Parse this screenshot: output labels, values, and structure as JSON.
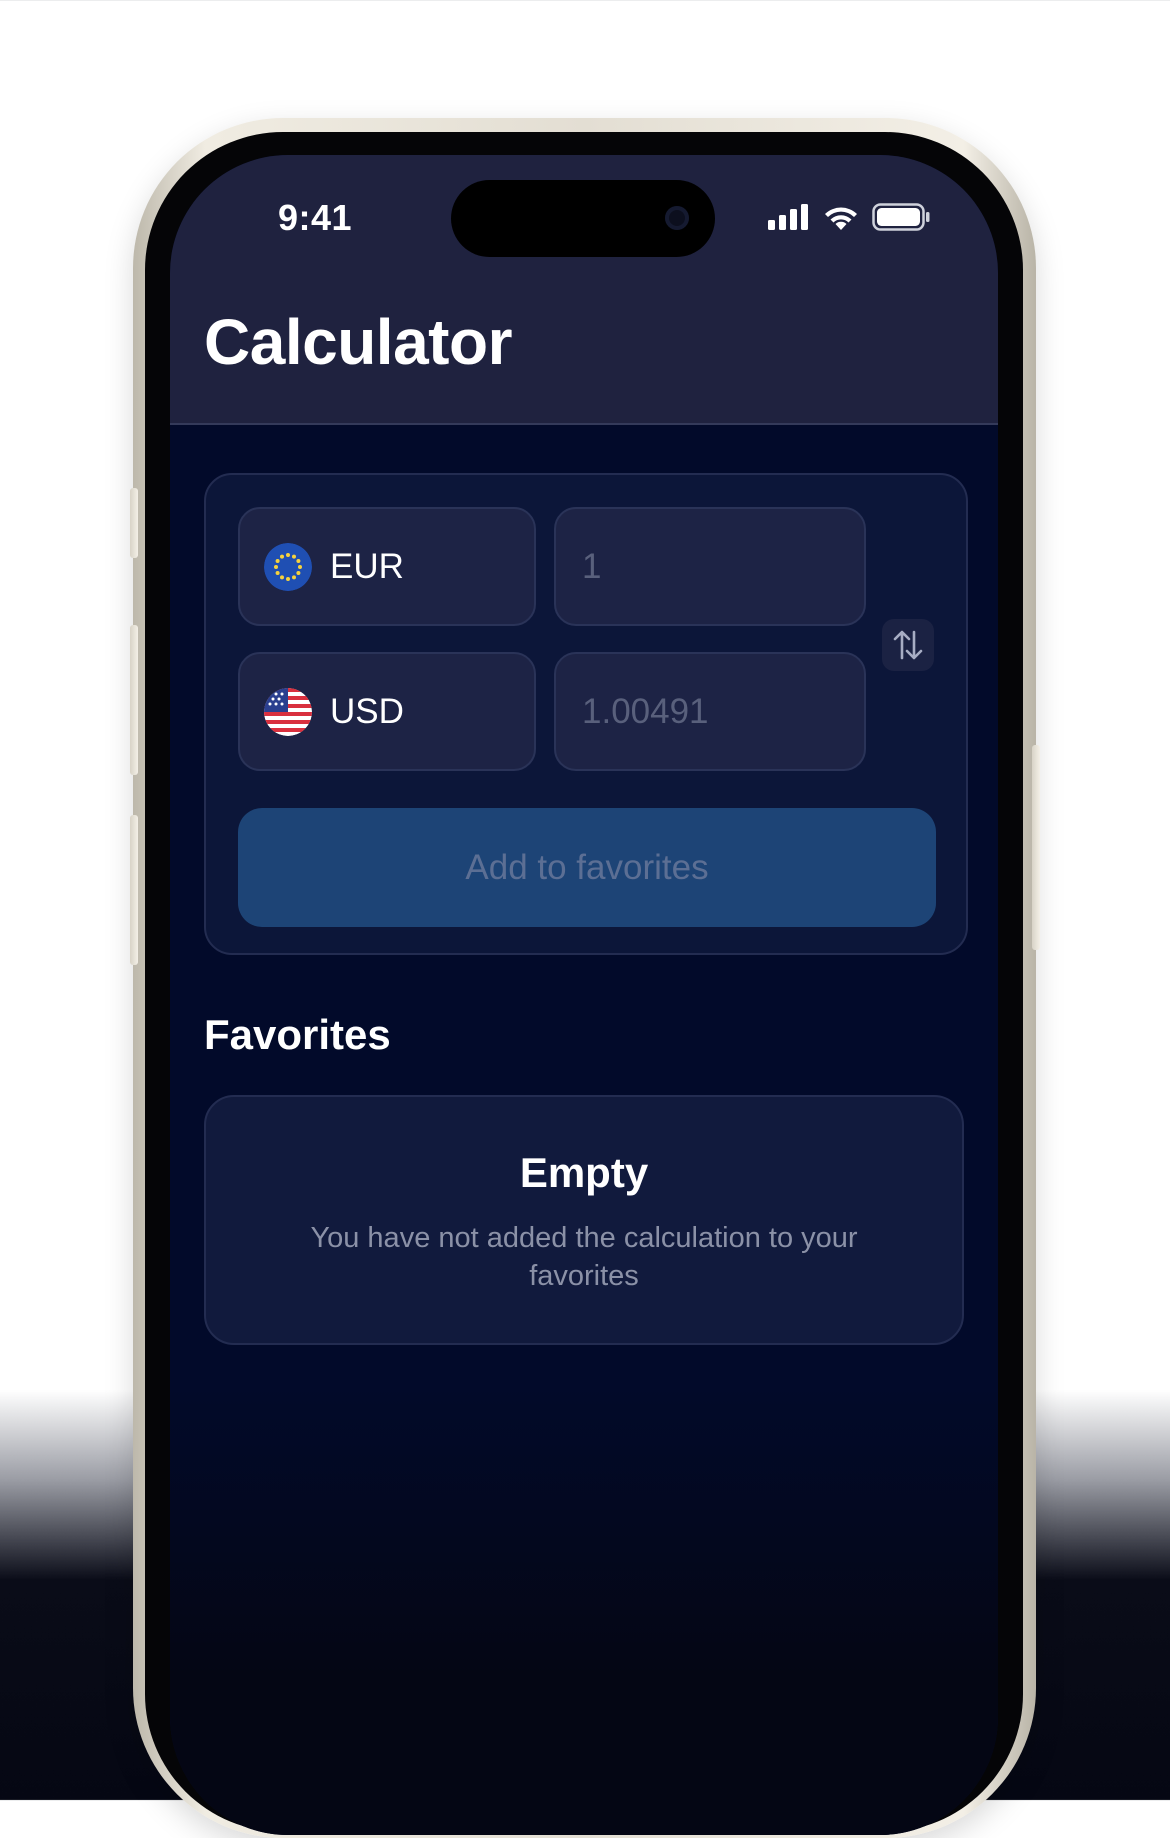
{
  "status_bar": {
    "time": "9:41"
  },
  "header": {
    "title": "Calculator"
  },
  "converter": {
    "from": {
      "currency": "EUR",
      "flag_icon": "eu-flag-icon",
      "value": "1"
    },
    "to": {
      "currency": "USD",
      "flag_icon": "us-flag-icon",
      "value": "1.00491"
    },
    "swap_icon": "swap-arrows-icon",
    "add_favorites_label": "Add to favorites"
  },
  "favorites": {
    "title": "Favorites",
    "empty_title": "Empty",
    "empty_message": "You have not added the calculation to your favorites"
  },
  "colors": {
    "header_bg": "#1f223f",
    "screen_bg": "#020a2a",
    "card_bg": "#0c1639",
    "button_bg": "#1d4476"
  }
}
